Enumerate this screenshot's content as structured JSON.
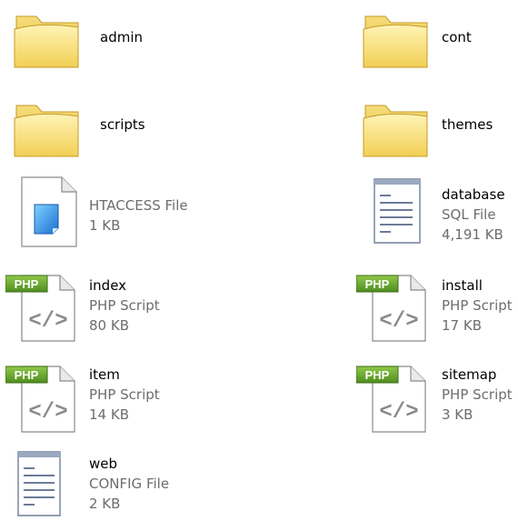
{
  "folders": [
    {
      "name": "admin"
    },
    {
      "name": "cont"
    },
    {
      "name": "scripts"
    },
    {
      "name": "themes"
    }
  ],
  "files": [
    {
      "name": "",
      "type": "HTACCESS File",
      "size": "1 KB",
      "icon": "generic-file-icon"
    },
    {
      "name": "database",
      "type": "SQL File",
      "size": "4,191 KB",
      "icon": "text-document-icon"
    },
    {
      "name": "index",
      "type": "PHP Script",
      "size": "80 KB",
      "icon": "php-file-icon"
    },
    {
      "name": "install",
      "type": "PHP Script",
      "size": "17 KB",
      "icon": "php-file-icon"
    },
    {
      "name": "item",
      "type": "PHP Script",
      "size": "14 KB",
      "icon": "php-file-icon"
    },
    {
      "name": "sitemap",
      "type": "PHP Script",
      "size": "3 KB",
      "icon": "php-file-icon"
    },
    {
      "name": "web",
      "type": "CONFIG File",
      "size": "2 KB",
      "icon": "text-document-icon"
    }
  ],
  "labels": {
    "php_badge": "PHP",
    "code_glyph": "</>"
  }
}
